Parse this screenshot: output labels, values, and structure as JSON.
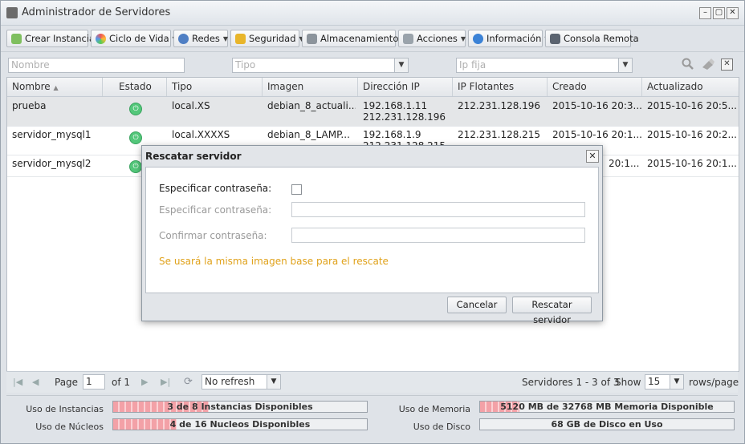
{
  "window": {
    "title": "Administrador de Servidores",
    "controls": [
      "–",
      "▢",
      "✕"
    ]
  },
  "toolbar": {
    "buttons": [
      {
        "label": "Crear Instancia",
        "icon": "add-server-icon",
        "dropdown": false
      },
      {
        "label": "Ciclo de Vida",
        "icon": "lifecycle-icon",
        "dropdown": true
      },
      {
        "label": "Redes",
        "icon": "globe-icon",
        "dropdown": true
      },
      {
        "label": "Seguridad",
        "icon": "lock-icon",
        "dropdown": true
      },
      {
        "label": "Almacenamiento",
        "icon": "storage-icon",
        "dropdown": true
      },
      {
        "label": "Acciones",
        "icon": "tools-icon",
        "dropdown": true
      },
      {
        "label": "Información",
        "icon": "info-icon",
        "dropdown": true
      },
      {
        "label": "Consola Remota",
        "icon": "console-icon",
        "dropdown": false
      }
    ]
  },
  "filters": {
    "name_placeholder": "Nombre",
    "type_placeholder": "Tipo",
    "ip_placeholder": "Ip fija"
  },
  "grid": {
    "columns": [
      "Nombre",
      "Estado",
      "Tipo",
      "Imagen",
      "Dirección IP",
      "IP Flotantes",
      "Creado",
      "Actualizado"
    ],
    "rows": [
      {
        "name": "prueba",
        "type": "local.XS",
        "image": "debian_8_actuali...",
        "ip1": "192.168.1.11",
        "ip2": "212.231.128.196",
        "floating": "212.231.128.196",
        "created": "2015-10-16 20:3...",
        "updated": "2015-10-16 20:5..."
      },
      {
        "name": "servidor_mysql1",
        "type": "local.XXXXS",
        "image": "debian_8_LAMP...",
        "ip1": "192.168.1.9",
        "ip2": "212.231.128.215",
        "floating": "212.231.128.215",
        "created": "2015-10-16 20:1...",
        "updated": "2015-10-16 20:2..."
      },
      {
        "name": "servidor_mysql2",
        "type": "",
        "image": "",
        "ip1": "",
        "ip2": "",
        "floating": "",
        "created": "20:1...",
        "updated": "2015-10-16 20:1..."
      }
    ]
  },
  "pager": {
    "page_label": "Page",
    "page_value": "1",
    "of_label": "of 1",
    "refresh": "No refresh",
    "summary": "Servidores 1 - 3 of 3",
    "show_label": "Show",
    "page_size": "15",
    "rows_label": "rows/page"
  },
  "stats": {
    "instances": {
      "label": "Uso de Instancias",
      "text": "3 de 8 Instancias Disponibles",
      "fraction": 0.375
    },
    "cores": {
      "label": "Uso de Núcleos",
      "text": "4 de 16 Nucleos Disponibles",
      "fraction": 0.25
    },
    "memory": {
      "label": "Uso de Memoria",
      "text": "5120 MB de 32768 MB Memoria Disponible",
      "fraction": 0.156
    },
    "disk": {
      "label": "Uso de Disco",
      "text": "68 GB de Disco en Uso",
      "fraction": 0
    }
  },
  "dialog": {
    "title": "Rescatar servidor",
    "close": "✕",
    "specify_label": "Especificar contraseña:",
    "password_label": "Especificar contraseña:",
    "confirm_label": "Confirmar contraseña:",
    "note": "Se usará la misma imagen base para el rescate",
    "cancel": "Cancelar",
    "submit": "Rescatar servidor"
  },
  "colors": {
    "accent_note": "#e0a21b",
    "status_on": "#53c77a",
    "usage_fill": "#f3a1a7"
  }
}
